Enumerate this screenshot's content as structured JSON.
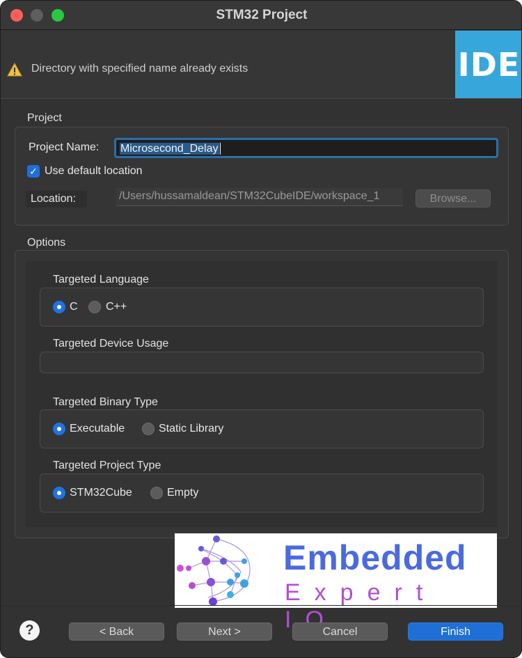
{
  "window": {
    "title": "STM32 Project"
  },
  "header": {
    "message": "Directory with specified name already exists",
    "logo_text": "IDE"
  },
  "project": {
    "group_label": "Project",
    "name_label": "Project Name:",
    "name_value": "Microsecond_Delay",
    "use_default_label": "Use default location",
    "use_default_checked": true,
    "location_label": "Location:",
    "location_value": "/Users/hussamaldean/STM32CubeIDE/workspace_1",
    "browse_label": "Browse..."
  },
  "options": {
    "group_label": "Options",
    "language": {
      "label": "Targeted Language",
      "options": [
        "C",
        "C++"
      ],
      "selected": "C"
    },
    "device_usage": {
      "label": "Targeted Device Usage"
    },
    "binary_type": {
      "label": "Targeted Binary Type",
      "options": [
        "Executable",
        "Static Library"
      ],
      "selected": "Executable"
    },
    "project_type": {
      "label": "Targeted Project Type",
      "options": [
        "STM32Cube",
        "Empty"
      ],
      "selected": "STM32Cube"
    }
  },
  "footer": {
    "help_symbol": "?",
    "back_label": "< Back",
    "next_label": "Next >",
    "cancel_label": "Cancel",
    "finish_label": "Finish"
  },
  "watermark": {
    "line1": "Embedded",
    "line2": "Expert IO"
  },
  "colors": {
    "accent": "#1f6fd6",
    "logo_bg": "#37a7db",
    "warning": "#f0c040"
  }
}
